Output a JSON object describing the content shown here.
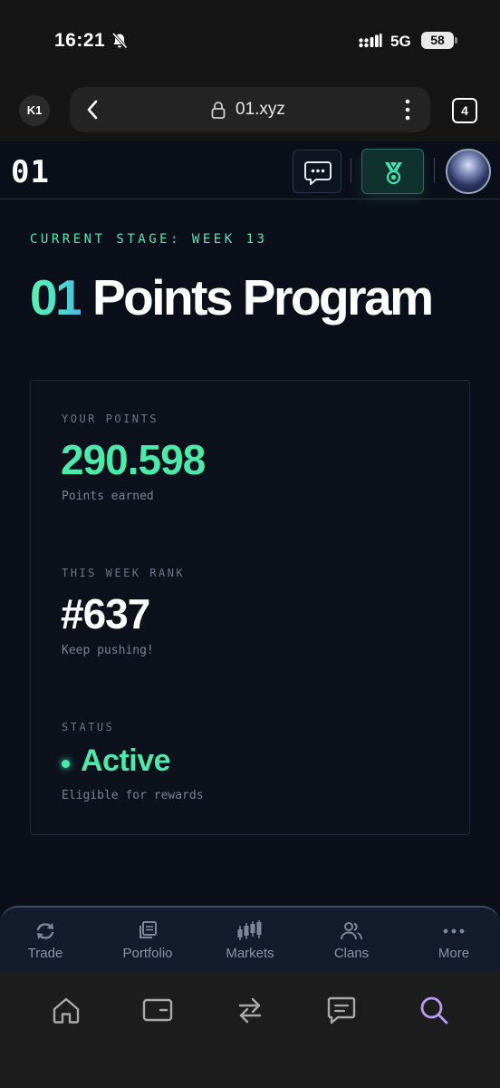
{
  "status_bar": {
    "time": "16:21",
    "network": "5G",
    "battery": "58"
  },
  "browser": {
    "profile": "K1",
    "url": "01.xyz",
    "tab_count": "4"
  },
  "app_header": {
    "logo": "01"
  },
  "main": {
    "stage_label": "CURRENT STAGE: WEEK 13",
    "title_accent": "01",
    "title_rest": " Points Program"
  },
  "card": {
    "points_label": "YOUR POINTS",
    "points_value": "290.598",
    "points_sub": "Points earned",
    "rank_label": "THIS WEEK RANK",
    "rank_value": "#637",
    "rank_sub": "Keep pushing!",
    "status_label": "STATUS",
    "status_value": "Active",
    "status_sub": "Eligible for rewards"
  },
  "bottom_nav": {
    "items": [
      {
        "label": "Trade",
        "icon": "swap-arrows-icon"
      },
      {
        "label": "Portfolio",
        "icon": "portfolio-stack-icon"
      },
      {
        "label": "Markets",
        "icon": "candlestick-icon"
      },
      {
        "label": "Clans",
        "icon": "users-icon"
      },
      {
        "label": "More",
        "icon": "more-dots-icon"
      }
    ]
  },
  "colors": {
    "background": "#0b0f1a",
    "accent_green": "#4ceaaa",
    "accent_blue": "#4fb8e6",
    "card_border": "#232b3a",
    "muted_text": "#6d7586"
  }
}
